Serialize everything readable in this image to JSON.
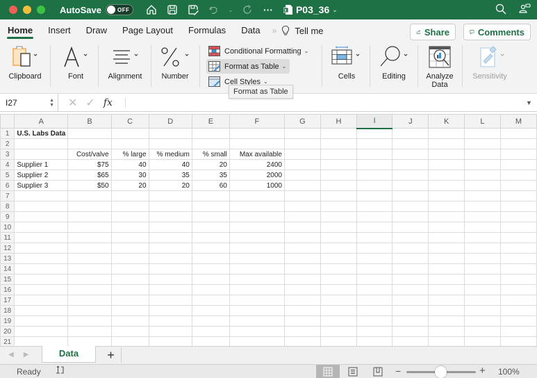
{
  "titlebar": {
    "autosave_label": "AutoSave",
    "autosave_state": "OFF",
    "file_name": "P03_36",
    "icons": [
      "home-icon",
      "save-icon",
      "save-as-icon",
      "undo-icon",
      "undo-dropdown-icon",
      "redo-icon",
      "more-icon",
      "excel-file-icon",
      "search-icon",
      "account-icon"
    ]
  },
  "tabs": [
    {
      "label": "Home",
      "active": true
    },
    {
      "label": "Insert"
    },
    {
      "label": "Draw"
    },
    {
      "label": "Page Layout"
    },
    {
      "label": "Formulas"
    },
    {
      "label": "Data"
    }
  ],
  "tell_me": "Tell me",
  "share_label": "Share",
  "comments_label": "Comments",
  "ribbon": {
    "clipboard": "Clipboard",
    "font": "Font",
    "alignment": "Alignment",
    "number": "Number",
    "conditional_formatting": "Conditional Formatting",
    "format_as_table": "Format as Table",
    "cell_styles": "Cell Styles",
    "cells": "Cells",
    "editing": "Editing",
    "analyze_data_1": "Analyze",
    "analyze_data_2": "Data",
    "sensitivity": "Sensitivity"
  },
  "tooltip": "Format as Table",
  "formula_bar": {
    "name_box": "I27",
    "fx_label": "fx",
    "formula": ""
  },
  "sheet": {
    "columns": [
      "A",
      "B",
      "C",
      "D",
      "E",
      "F",
      "G",
      "H",
      "I",
      "J",
      "K",
      "L",
      "M"
    ],
    "selected_column": "I",
    "rows": [
      {
        "n": "1",
        "cells": [
          "U.S. Labs Data",
          "",
          "",
          "",
          "",
          ""
        ]
      },
      {
        "n": "2",
        "cells": [
          "",
          "",
          "",
          "",
          "",
          ""
        ]
      },
      {
        "n": "3",
        "cells": [
          "",
          "Cost/valve",
          "% large",
          "% medium",
          "% small",
          "Max available"
        ]
      },
      {
        "n": "4",
        "cells": [
          "Supplier 1",
          "$75",
          "40",
          "40",
          "20",
          "2400"
        ]
      },
      {
        "n": "5",
        "cells": [
          "Supplier 2",
          "$65",
          "30",
          "35",
          "35",
          "2000"
        ]
      },
      {
        "n": "6",
        "cells": [
          "Supplier 3",
          "$50",
          "20",
          "20",
          "60",
          "1000"
        ]
      },
      {
        "n": "7",
        "cells": [
          "",
          "",
          "",
          "",
          "",
          ""
        ]
      },
      {
        "n": "8",
        "cells": [
          "",
          "",
          "",
          "",
          "",
          ""
        ]
      },
      {
        "n": "9",
        "cells": [
          "",
          "",
          "",
          "",
          "",
          ""
        ]
      },
      {
        "n": "10",
        "cells": [
          "",
          "",
          "",
          "",
          "",
          ""
        ]
      },
      {
        "n": "11",
        "cells": [
          "",
          "",
          "",
          "",
          "",
          ""
        ]
      },
      {
        "n": "12",
        "cells": [
          "",
          "",
          "",
          "",
          "",
          ""
        ]
      },
      {
        "n": "13",
        "cells": [
          "",
          "",
          "",
          "",
          "",
          ""
        ]
      },
      {
        "n": "14",
        "cells": [
          "",
          "",
          "",
          "",
          "",
          ""
        ]
      },
      {
        "n": "15",
        "cells": [
          "",
          "",
          "",
          "",
          "",
          ""
        ]
      },
      {
        "n": "16",
        "cells": [
          "",
          "",
          "",
          "",
          "",
          ""
        ]
      },
      {
        "n": "17",
        "cells": [
          "",
          "",
          "",
          "",
          "",
          ""
        ]
      },
      {
        "n": "18",
        "cells": [
          "",
          "",
          "",
          "",
          "",
          ""
        ]
      },
      {
        "n": "19",
        "cells": [
          "",
          "",
          "",
          "",
          "",
          ""
        ]
      },
      {
        "n": "20",
        "cells": [
          "",
          "",
          "",
          "",
          "",
          ""
        ]
      },
      {
        "n": "21",
        "cells": [
          "",
          "",
          "",
          "",
          "",
          ""
        ]
      }
    ]
  },
  "sheet_tabs": [
    {
      "label": "Data",
      "active": true
    }
  ],
  "add_sheet": "+",
  "status": {
    "ready": "Ready",
    "zoom_minus": "−",
    "zoom_plus": "+",
    "zoom_level": "100%"
  },
  "colors": {
    "brand_green": "#1e7145",
    "ribbon_bg": "#f3f3f3"
  }
}
